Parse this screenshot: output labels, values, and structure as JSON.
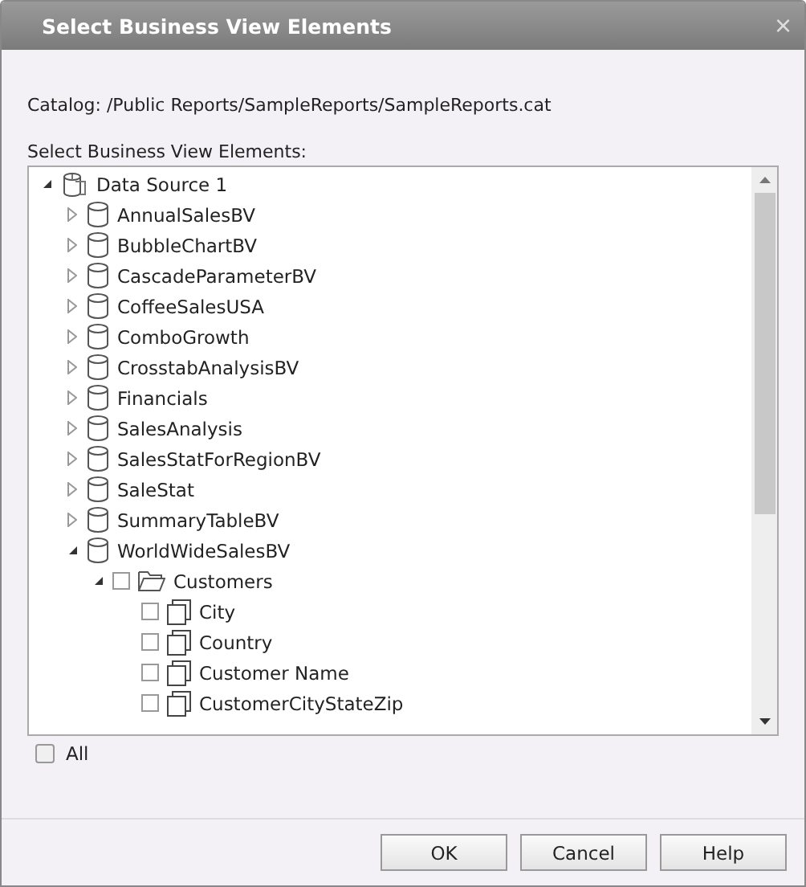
{
  "window": {
    "title": "Select Business View Elements",
    "close": "×"
  },
  "catalog": "Catalog: /Public Reports/SampleReports/SampleReports.cat",
  "tree_label": "Select Business View Elements:",
  "tree": [
    {
      "kind": "datasource",
      "label": "Data Source 1",
      "expanded": true,
      "children": [
        {
          "kind": "bv",
          "label": "AnnualSalesBV",
          "expanded": false
        },
        {
          "kind": "bv",
          "label": "BubbleChartBV",
          "expanded": false
        },
        {
          "kind": "bv",
          "label": "CascadeParameterBV",
          "expanded": false
        },
        {
          "kind": "bv",
          "label": "CoffeeSalesUSA",
          "expanded": false
        },
        {
          "kind": "bv",
          "label": "ComboGrowth",
          "expanded": false
        },
        {
          "kind": "bv",
          "label": "CrosstabAnalysisBV",
          "expanded": false
        },
        {
          "kind": "bv",
          "label": "Financials",
          "expanded": false
        },
        {
          "kind": "bv",
          "label": "SalesAnalysis",
          "expanded": false
        },
        {
          "kind": "bv",
          "label": "SalesStatForRegionBV",
          "expanded": false
        },
        {
          "kind": "bv",
          "label": "SaleStat",
          "expanded": false
        },
        {
          "kind": "bv",
          "label": "SummaryTableBV",
          "expanded": false
        },
        {
          "kind": "bv",
          "label": "WorldWideSalesBV",
          "expanded": true,
          "children": [
            {
              "kind": "folder",
              "label": "Customers",
              "expanded": true,
              "checked": false,
              "children": [
                {
                  "kind": "field",
                  "label": "City",
                  "checked": false
                },
                {
                  "kind": "field",
                  "label": "Country",
                  "checked": false
                },
                {
                  "kind": "field",
                  "label": "Customer Name",
                  "checked": false
                },
                {
                  "kind": "field",
                  "label": "CustomerCityStateZip",
                  "checked": false
                }
              ]
            }
          ]
        }
      ]
    }
  ],
  "all": {
    "label": "All",
    "checked": false
  },
  "buttons": [
    "OK",
    "Cancel",
    "Help"
  ]
}
